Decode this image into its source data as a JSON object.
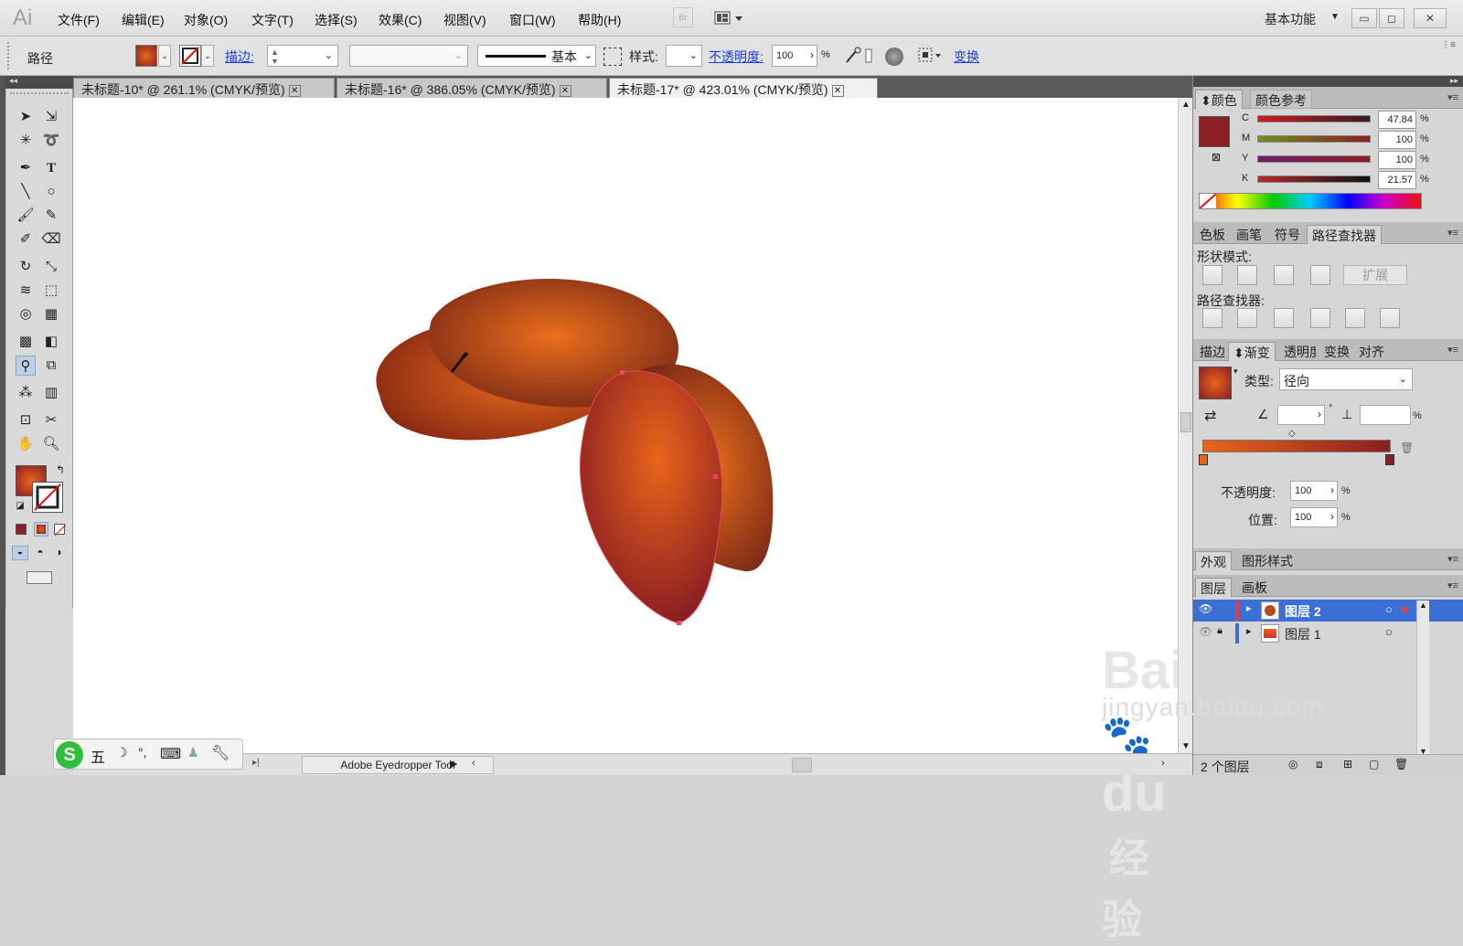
{
  "app": {
    "logo": "Ai",
    "bridge": "Br",
    "workspace": "基本功能"
  },
  "menu": [
    "文件(F)",
    "编辑(E)",
    "对象(O)",
    "文字(T)",
    "选择(S)",
    "效果(C)",
    "视图(V)",
    "窗口(W)",
    "帮助(H)"
  ],
  "control": {
    "selection_type": "路径",
    "stroke_label": "描边:",
    "stroke_profile": "基本",
    "style_label": "样式:",
    "opacity_label": "不透明度:",
    "opacity_value": "100",
    "opacity_unit": "%",
    "transform_label": "变换"
  },
  "tabs": [
    {
      "label": "未标题-10* @ 261.1% (CMYK/预览)",
      "active": false
    },
    {
      "label": "未标题-16* @ 386.05% (CMYK/预览)",
      "active": false
    },
    {
      "label": "未标题-17* @ 423.01% (CMYK/预览)",
      "active": true
    }
  ],
  "status": {
    "tool": "Adobe Eyedropper Tool"
  },
  "color_panel": {
    "tabs": [
      "颜色",
      "颜色参考"
    ],
    "channels": [
      {
        "name": "C",
        "value": "47.84"
      },
      {
        "name": "M",
        "value": "100"
      },
      {
        "name": "Y",
        "value": "100"
      },
      {
        "name": "K",
        "value": "21.57"
      }
    ],
    "unit": "%",
    "fill_color": "#8b1e22"
  },
  "pathfinder_panel": {
    "tabs": [
      "色板",
      "画笔",
      "符号",
      "路径查找器"
    ],
    "shape_modes_label": "形状模式:",
    "expand_label": "扩展",
    "pathfinders_label": "路径查找器:"
  },
  "gradient_panel": {
    "tabs": [
      "描边",
      "渐变",
      "透明度",
      "变换",
      "对齐"
    ],
    "type_label": "类型:",
    "type_value": "径向",
    "opacity_label": "不透明度:",
    "opacity_value": "100",
    "location_label": "位置:",
    "location_value": "100",
    "unit": "%",
    "degree": "°",
    "start_color": "#e8651c",
    "end_color": "#8b1e22"
  },
  "appearance_panel": {
    "tabs": [
      "外观",
      "图形样式"
    ]
  },
  "layers_panel": {
    "tabs": [
      "图层",
      "画板"
    ],
    "layers": [
      {
        "name": "图层 2",
        "selected": true
      },
      {
        "name": "图层 1",
        "selected": false
      }
    ],
    "footer": "2 个图层"
  },
  "ime": {
    "chars": [
      "五"
    ]
  },
  "watermark": {
    "brand": "Bai",
    "brand2": "du",
    "site": "经验",
    "url": "jingyan.baidu.com"
  }
}
